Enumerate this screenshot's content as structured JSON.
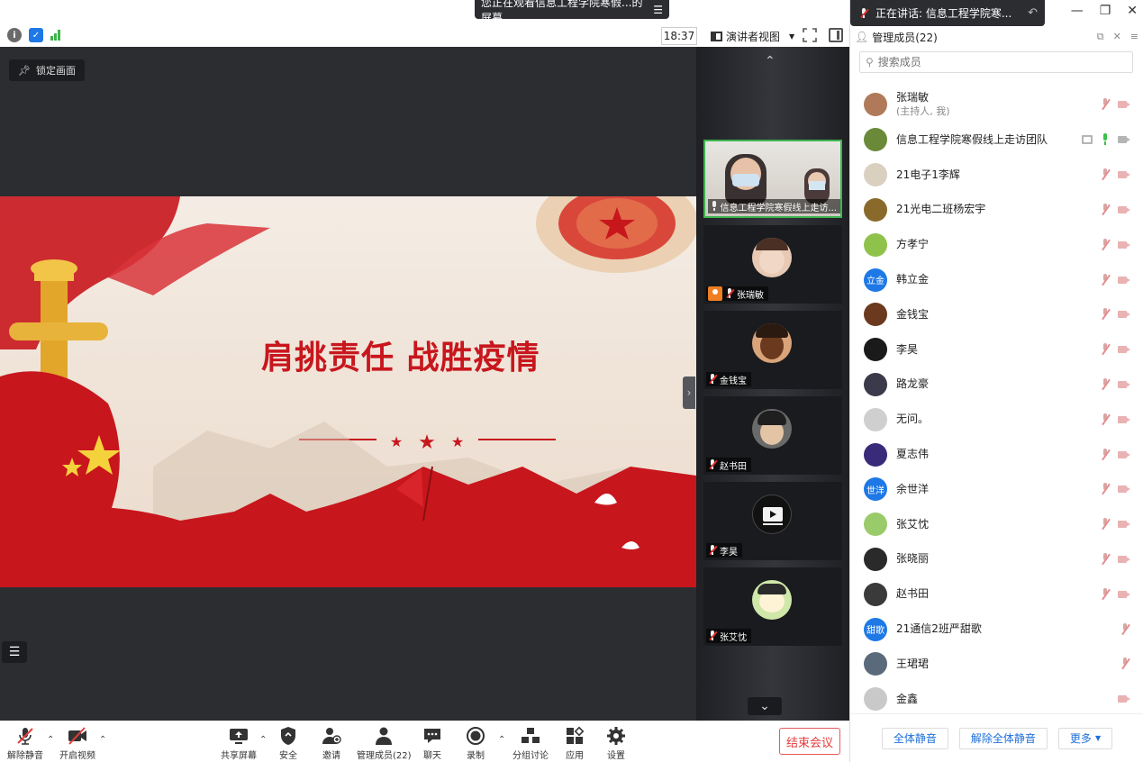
{
  "banner": {
    "watching": "您正在观看信息工程学院寒假...的屏幕"
  },
  "topbar": {
    "clock": "18:37",
    "view_label": "演讲者视图"
  },
  "stage": {
    "lock_label": "锁定画面",
    "slide_title": "肩挑责任 战胜疫情"
  },
  "gallery": {
    "tiles": [
      {
        "label": "信息工程学院寒假线上走访..."
      },
      {
        "label": "张瑞敏"
      },
      {
        "label": "金钱宝"
      },
      {
        "label": "赵书田"
      },
      {
        "label": "李昊"
      },
      {
        "label": "张艾忱"
      }
    ]
  },
  "panel": {
    "speaking": "正在讲话: 信息工程学院寒...",
    "header": "管理成员(22)",
    "search_placeholder": "搜索成员",
    "members": [
      {
        "name": "张瑞敏",
        "sub": "(主持人, 我)",
        "color": "#b07a5a",
        "mic": "off",
        "cam": "off"
      },
      {
        "name": "信息工程学院寒假线上走访团队",
        "color": "#6a8a3a",
        "mic": "on",
        "cam": "on",
        "share": true
      },
      {
        "name": "21电子1李辉",
        "color": "#d9d0c0",
        "mic": "off",
        "cam": "off"
      },
      {
        "name": "21光电二班杨宏宇",
        "color": "#8a6a2a",
        "mic": "off",
        "cam": "off"
      },
      {
        "name": "方孝宁",
        "color": "#8fc24a",
        "mic": "off",
        "cam": "off"
      },
      {
        "name": "韩立金",
        "initials": "立金",
        "color": "#1e78e6",
        "mic": "off",
        "cam": "off"
      },
      {
        "name": "金钱宝",
        "color": "#6b3a1e",
        "mic": "off",
        "cam": "off"
      },
      {
        "name": "李昊",
        "color": "#1a1a1a",
        "mic": "off",
        "cam": "off"
      },
      {
        "name": "路龙豪",
        "color": "#3a3a4a",
        "mic": "off",
        "cam": "off"
      },
      {
        "name": "无问。",
        "color": "#cfcfcf",
        "mic": "off",
        "cam": "off"
      },
      {
        "name": "夏志伟",
        "color": "#3a2a7a",
        "mic": "off",
        "cam": "off"
      },
      {
        "name": "余世洋",
        "initials": "世洋",
        "color": "#1e78e6",
        "mic": "off",
        "cam": "off"
      },
      {
        "name": "张艾忱",
        "color": "#9acb6a",
        "mic": "off",
        "cam": "off"
      },
      {
        "name": "张晓丽",
        "color": "#2a2a2a",
        "mic": "off",
        "cam": "off"
      },
      {
        "name": "赵书田",
        "color": "#3a3a3a",
        "mic": "off",
        "cam": "off"
      },
      {
        "name": "21通信2班严甜歌",
        "initials": "甜歌",
        "color": "#1e78e6",
        "mic": "off",
        "cam": "none"
      },
      {
        "name": "王珺珺",
        "color": "#5a6a7a",
        "mic": "off",
        "cam": "none"
      },
      {
        "name": "金鑫",
        "color": "#c9c9c9",
        "mic": "none",
        "cam": "off"
      }
    ],
    "footer": {
      "mute_all": "全体静音",
      "unmute_all": "解除全体静音",
      "more": "更多"
    }
  },
  "toolbar": {
    "unmute": "解除静音",
    "start_video": "开启视频",
    "share": "共享屏幕",
    "security": "安全",
    "invite": "邀请",
    "manage": "管理成员(22)",
    "chat": "聊天",
    "record": "录制",
    "breakout": "分组讨论",
    "apps": "应用",
    "settings": "设置",
    "end": "结束会议"
  },
  "colors": {
    "accent": "#1e6fd9",
    "danger": "#e53c3c",
    "active_speaker": "#3eb34f",
    "slide_red": "#c8161d"
  }
}
